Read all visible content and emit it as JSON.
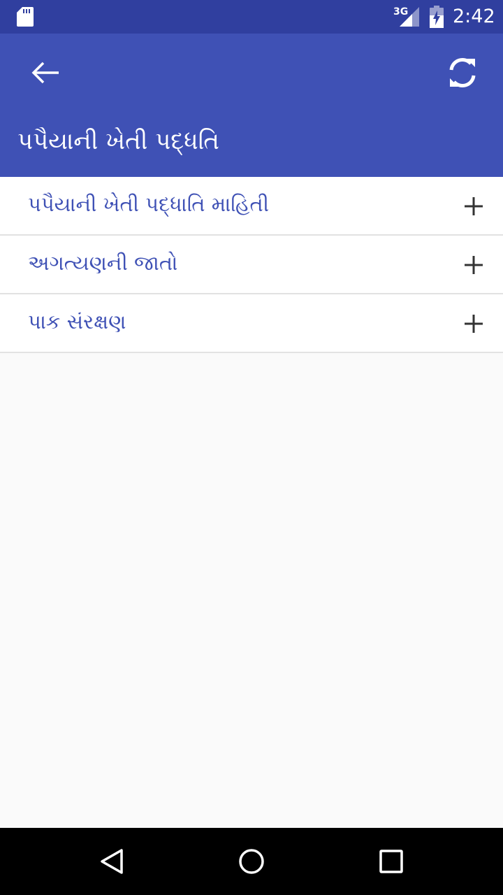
{
  "status_bar": {
    "network": "3G",
    "time": "2:42",
    "icons": [
      "sd-card-icon",
      "signal-icon",
      "battery-charging-icon"
    ]
  },
  "app_bar": {
    "title": "પપૈયાની ખેતી પદ્ધતિ",
    "back_icon": "arrow-back-icon",
    "refresh_icon": "refresh-icon"
  },
  "list": {
    "items": [
      {
        "label": "પપૈયાની ખેતી પદ્ધાતિ માહિતી",
        "icon": "plus-icon"
      },
      {
        "label": "અગત્યણની  જાતો",
        "icon": "plus-icon"
      },
      {
        "label": "પાક સંરક્ષણ",
        "icon": "plus-icon"
      }
    ]
  },
  "nav_bar": {
    "icons": [
      "nav-back-icon",
      "nav-home-icon",
      "nav-recent-apps-icon"
    ]
  },
  "colors": {
    "status_bar": "#303f9f",
    "app_bar": "#3f51b5",
    "item_text": "#3f51b5",
    "background": "#fafafa",
    "nav_bar": "#000000"
  }
}
